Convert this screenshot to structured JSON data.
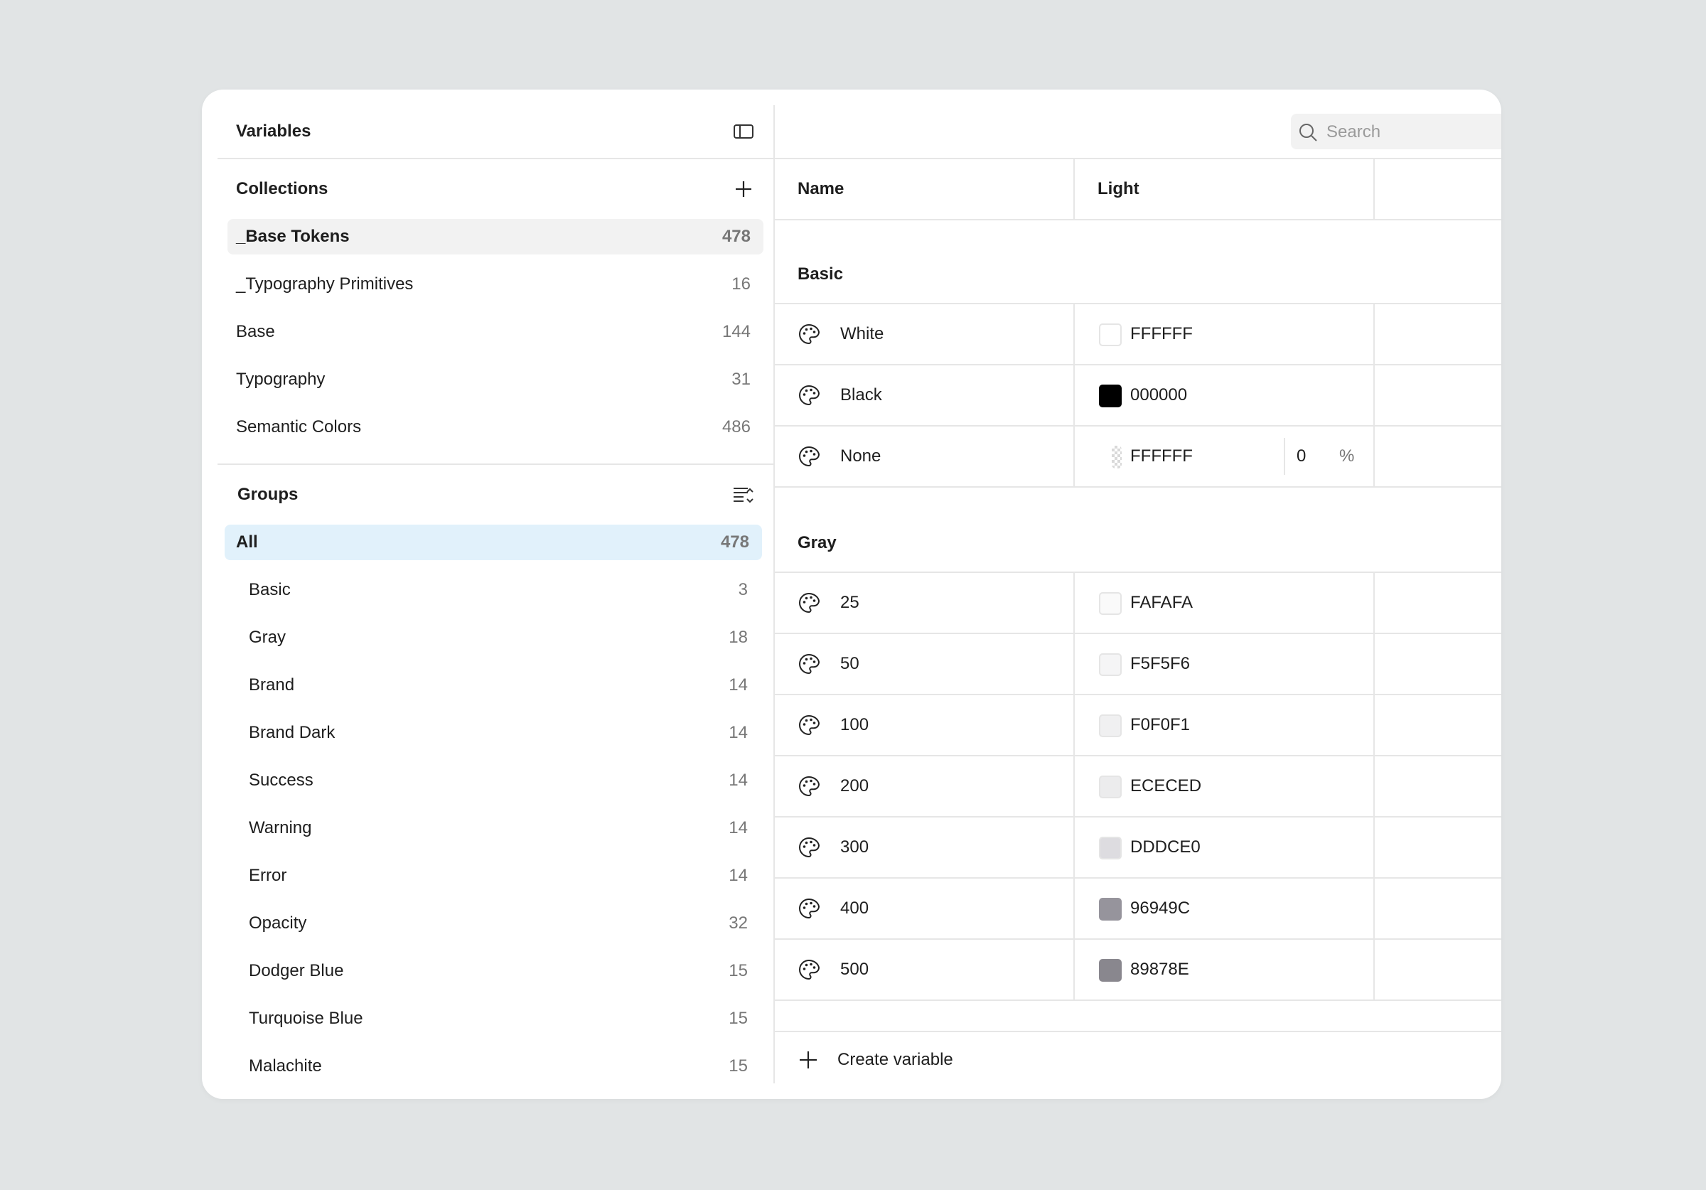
{
  "app": {
    "title": "Variables"
  },
  "collections": {
    "heading": "Collections",
    "items": [
      {
        "label": "_Base Tokens",
        "count": "478"
      },
      {
        "label": "_Typography Primitives",
        "count": "16"
      },
      {
        "label": "Base",
        "count": "144"
      },
      {
        "label": "Typography",
        "count": "31"
      },
      {
        "label": "Semantic Colors",
        "count": "486"
      }
    ]
  },
  "groups": {
    "heading": "Groups",
    "all": {
      "label": "All",
      "count": "478"
    },
    "items": [
      {
        "label": "Basic",
        "count": "3"
      },
      {
        "label": "Gray",
        "count": "18"
      },
      {
        "label": "Brand",
        "count": "14"
      },
      {
        "label": "Brand Dark",
        "count": "14"
      },
      {
        "label": "Success",
        "count": "14"
      },
      {
        "label": "Warning",
        "count": "14"
      },
      {
        "label": "Error",
        "count": "14"
      },
      {
        "label": "Opacity",
        "count": "32"
      },
      {
        "label": "Dodger Blue",
        "count": "15"
      },
      {
        "label": "Turquoise Blue",
        "count": "15"
      },
      {
        "label": "Malachite",
        "count": "15"
      }
    ]
  },
  "search": {
    "placeholder": "Search"
  },
  "table": {
    "col_name": "Name",
    "col_mode": "Light",
    "sections": [
      {
        "title": "Basic",
        "rows": [
          {
            "name": "White",
            "hex": "FFFFFF",
            "color": "#FFFFFF"
          },
          {
            "name": "Black",
            "hex": "000000",
            "color": "#000000"
          },
          {
            "name": "None",
            "hex": "FFFFFF",
            "color": "transparent",
            "opacity": "0",
            "opacity_unit": "%"
          }
        ]
      },
      {
        "title": "Gray",
        "rows": [
          {
            "name": "25",
            "hex": "FAFAFA",
            "color": "#FAFAFA"
          },
          {
            "name": "50",
            "hex": "F5F5F6",
            "color": "#F5F5F6"
          },
          {
            "name": "100",
            "hex": "F0F0F1",
            "color": "#F0F0F1"
          },
          {
            "name": "200",
            "hex": "ECECED",
            "color": "#ECECED"
          },
          {
            "name": "300",
            "hex": "DDDCE0",
            "color": "#DDDCE0"
          },
          {
            "name": "400",
            "hex": "96949C",
            "color": "#96949C"
          },
          {
            "name": "500",
            "hex": "89878E",
            "color": "#89878E"
          }
        ]
      }
    ]
  },
  "footer": {
    "create_label": "Create variable"
  },
  "colors": {
    "active_collection_bg": "#f2f2f2",
    "active_group_bg": "#e1f1fb",
    "page_bg": "#e1e4e5"
  }
}
